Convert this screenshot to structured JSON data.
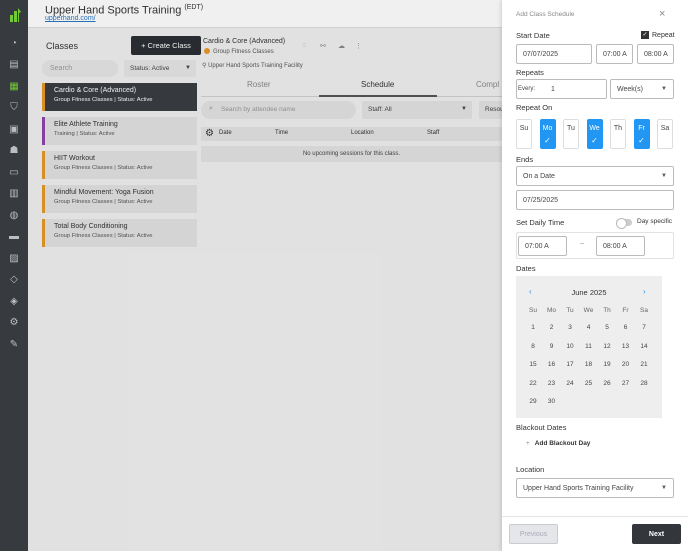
{
  "header": {
    "brand": "Upper Hand Sports Training",
    "brand_tz": "(EDT)",
    "brand_link": "upperhand.com/"
  },
  "rail": {
    "icons": [
      "dashboard-icon",
      "book-icon",
      "calendar-icon",
      "shirt-icon",
      "briefcase-icon",
      "users-icon",
      "message-icon",
      "chart-icon",
      "globe-icon",
      "ticket-icon",
      "id-card-icon",
      "tag-icon",
      "coupon-icon",
      "gear-icon",
      "tools-icon"
    ],
    "active": 2
  },
  "classes": {
    "title": "Classes",
    "create_label": "+ Create Class",
    "search_placeholder": "Search",
    "status_filter": "Status: Active",
    "items": [
      {
        "title": "Cardio & Core (Advanced)",
        "subtitle": "Group Fitness Classes | Status: Active"
      },
      {
        "title": "Elite Athlete Training",
        "subtitle": "Training | Status: Active"
      },
      {
        "title": "HIIT Workout",
        "subtitle": "Group Fitness Classes | Status: Active"
      },
      {
        "title": "Mindful Movement: Yoga Fusion",
        "subtitle": "Group Fitness Classes | Status: Active"
      },
      {
        "title": "Total Body Conditioning",
        "subtitle": "Group Fitness Classes | Status: Active"
      }
    ]
  },
  "detail": {
    "title": "Cardio & Core (Advanced)",
    "category": "Group Fitness Classes",
    "facility": "Upper Hand Sports Training Facility",
    "tabs": [
      "Roster",
      "Schedule",
      "Compl"
    ],
    "attendee_search_placeholder": "Search by attendee name",
    "staff_filter": "Staff: All",
    "resource_filter": "Resou",
    "columns": [
      "Date",
      "Time",
      "Location",
      "Staff"
    ],
    "empty_text": "No upcoming sessions for this class."
  },
  "panel": {
    "title": "Add Class Schedule",
    "start_date_label": "Start Date",
    "repeat_label": "Repeat",
    "repeat_checked": "✓",
    "start_date": "07/07/2025",
    "start_time": "07:00 A",
    "end_time": "08:00 A",
    "repeats_label": "Repeats",
    "every_label": "Every:",
    "every_value": "1",
    "period": "Week(s)",
    "repeat_on_label": "Repeat On",
    "days": [
      {
        "d": "Su",
        "on": false
      },
      {
        "d": "Mo",
        "on": true
      },
      {
        "d": "Tu",
        "on": false
      },
      {
        "d": "We",
        "on": true
      },
      {
        "d": "Th",
        "on": false
      },
      {
        "d": "Fr",
        "on": true
      },
      {
        "d": "Sa",
        "on": false
      }
    ],
    "ends_label": "Ends",
    "ends_mode": "On a Date",
    "ends_date": "07/25/2025",
    "daily_time_label": "Set Daily Time",
    "day_specific_label": "Day specific",
    "daily_start": "07:00 A",
    "daily_sep": "–",
    "daily_end": "08:00 A",
    "dates_label": "Dates",
    "calendar": {
      "month": "June 2025",
      "prev": "‹",
      "next": "›",
      "dow": [
        "Su",
        "Mo",
        "Tu",
        "We",
        "Th",
        "Fr",
        "Sa"
      ],
      "weeks": [
        [
          "1",
          "2",
          "3",
          "4",
          "5",
          "6",
          "7"
        ],
        [
          "8",
          "9",
          "10",
          "11",
          "12",
          "13",
          "14"
        ],
        [
          "15",
          "16",
          "17",
          "18",
          "19",
          "20",
          "21"
        ],
        [
          "22",
          "23",
          "24",
          "25",
          "26",
          "27",
          "28"
        ],
        [
          "29",
          "30",
          "",
          "",
          "",
          "",
          ""
        ]
      ]
    },
    "blackout_label": "Blackout Dates",
    "add_blackout_plus": "+",
    "add_blackout": "Add Blackout Day",
    "location_label": "Location",
    "location": "Upper Hand Sports Training Facility",
    "prev_label": "Previous",
    "next_label": "Next",
    "close": "×"
  }
}
